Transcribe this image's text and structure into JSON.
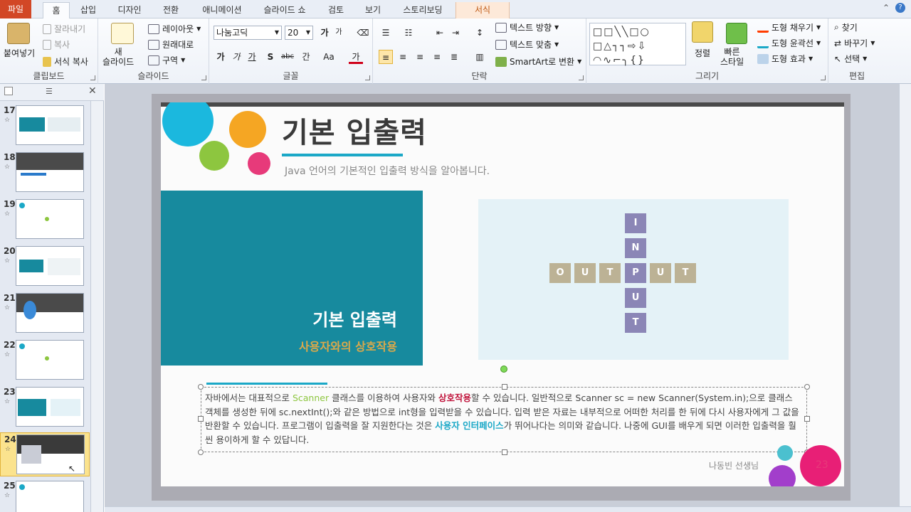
{
  "ribbon": {
    "tabs": [
      "파일",
      "홈",
      "삽입",
      "디자인",
      "전환",
      "애니메이션",
      "슬라이드 쇼",
      "검토",
      "보기",
      "스토리보딩",
      "서식"
    ],
    "clipboard": {
      "paste": "붙여넣기",
      "cut": "잘라내기",
      "copy": "복사",
      "format_painter": "서식 복사",
      "label": "클립보드"
    },
    "slides": {
      "new_slide": "새\n슬라이드",
      "layout": "레이아웃",
      "reset": "원래대로",
      "section": "구역",
      "label": "슬라이드"
    },
    "font": {
      "name": "나눔고딕",
      "size": "20",
      "grow": "가",
      "shrink": "가",
      "bold": "가",
      "italic": "가",
      "underline": "가",
      "shadow": "S",
      "strike": "abc",
      "spacing": "간",
      "case": "Aa",
      "color": "가",
      "label": "글꼴"
    },
    "paragraph": {
      "text_direction": "텍스트 방향",
      "align_text": "텍스트 맞춤",
      "smartart": "SmartArt로 변환",
      "label": "단락"
    },
    "drawing": {
      "shapes": "□□╲╲□○\n□△┐┐⇨⇩\n◠∿⌐╮{}",
      "arrange": "정렬",
      "quick_styles": "빠른\n스타일",
      "fill": "도형 채우기",
      "outline": "도형 윤곽선",
      "effects": "도형 효과",
      "label": "그리기"
    },
    "editing": {
      "find": "찾기",
      "replace": "바꾸기",
      "select": "선택",
      "label": "편집"
    }
  },
  "thumbnails": [
    {
      "num": "17",
      "star": "☆"
    },
    {
      "num": "18",
      "star": "☆"
    },
    {
      "num": "19",
      "star": "☆"
    },
    {
      "num": "20",
      "star": "☆"
    },
    {
      "num": "21",
      "star": "☆"
    },
    {
      "num": "22",
      "star": "☆"
    },
    {
      "num": "23",
      "star": "☆"
    },
    {
      "num": "24",
      "star": "☆"
    },
    {
      "num": "25",
      "star": "☆"
    }
  ],
  "slide": {
    "title": "기본 입출력",
    "subtitle": "Java 언어의 기본적인 입출력 방식을 알아봅니다.",
    "panel_title": "기본 입출력",
    "panel_subtitle": "사용자와의 상호작용",
    "input_letters": [
      "I",
      "N",
      "P",
      "U",
      "T"
    ],
    "output_letters": [
      "O",
      "U",
      "T",
      "P",
      "U",
      "T"
    ],
    "body": {
      "t1": "자바에서는 대표적으로 ",
      "scanner": "Scanner",
      "t2": " 클래스를 이용하여 사용자와 ",
      "interaction": "상호작용",
      "t3": "할 수 있습니다.  일반적으로 Scanner sc = new Scanner(System.in);으로 클래스 객체를 생성한 뒤에 sc.nextInt();와 같은 방법으로 int형을 입력받을 수 있습니다. 입력 받은 자료는 내부적으로 어떠한 처리를 한 뒤에 다시 사용자에게 그 값을 반환할 수 있습니다. 프로그램이 입출력을 잘 지원한다는 것은 ",
      "ui": "사용자 인터페이스",
      "t4": "가 뛰어나다는 의미와 같습니다. 나중에 GUI를 배우게 되면 이러한 입출력을 훨씬 용이하게 할 수 있답니다."
    },
    "author": "나동빈 선생님",
    "page_number": "23"
  },
  "colors": {
    "teal": "#178a9e",
    "accent_blue": "#1ba8c7",
    "orange": "#f5a623",
    "green": "#8dc63f",
    "pink": "#e73a7a",
    "purple": "#a23ecb",
    "input_tile": "#8b86b6",
    "output_tile": "#bcb295"
  }
}
